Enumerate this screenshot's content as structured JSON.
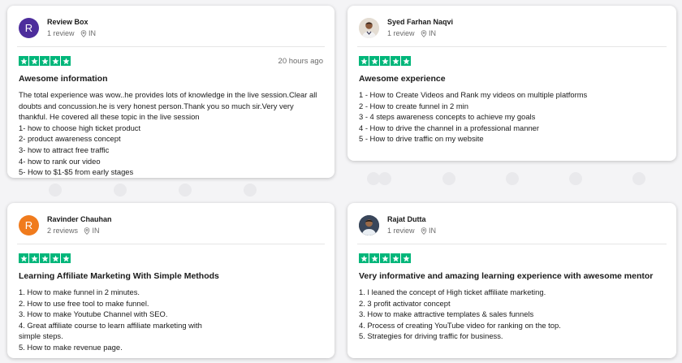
{
  "reviews": [
    {
      "name": "Review Box",
      "initial": "R",
      "avatar_color": "#4d2d9c",
      "count": "1 review",
      "country": "IN",
      "date": "20 hours ago",
      "title": "Awesome information",
      "lines": [
        "The total experience was wow..he provides lots of knowledge in the live session.Clear all doubts and concussion.he is very honest person.Thank you so much sir.Very very thankful. He covered all these topic in the live session",
        "1- how to choose high ticket product",
        "2- product awareness concept",
        "3- how to attract free traffic",
        "4- how to rank our video",
        "5- How to $1-$5 from early stages"
      ]
    },
    {
      "name": "Syed Farhan Naqvi",
      "initial": "",
      "avatar_color": "#c9b39a",
      "count": "1 review",
      "country": "IN",
      "date": "",
      "title": "Awesome experience",
      "lines": [
        "1 - How to Create Videos and Rank my videos on multiple platforms",
        "2 - How to create funnel in 2 min",
        "3 - 4 steps awareness concepts to achieve my goals",
        "4 - How to drive the channel in a professional manner",
        "5 - How to drive traffic on my website"
      ]
    },
    {
      "name": "Ravinder Chauhan",
      "initial": "R",
      "avatar_color": "#f07b1d",
      "count": "2 reviews",
      "country": "IN",
      "date": "",
      "title": "Learning Affiliate Marketing With Simple Methods",
      "lines": [
        "1. How to make funnel in 2 minutes.",
        "2. How to use free tool to make funnel.",
        "3. How to make Youtube Channel with SEO.",
        "4. Great affiliate course to learn affiliate marketing with simple steps.",
        "5. How to make revenue page."
      ]
    },
    {
      "name": "Rajat Dutta",
      "initial": "",
      "avatar_color": "#2f3a4a",
      "count": "1 review",
      "country": "IN",
      "date": "",
      "title": "Very informative and amazing learning experience with awesome mentor",
      "lines": [
        "1. I leaned the concept of High ticket affiliate marketing.",
        "2. 3 profit activator concept",
        "3. How to make attractive templates & sales funnels",
        "4. Process of creating YouTube video for ranking on the top.",
        "5. Strategies for driving traffic for business."
      ]
    }
  ],
  "rating_stars": 5,
  "star_color": "#00b67a",
  "icons": {
    "location": "map-pin-icon",
    "star": "star-icon"
  }
}
